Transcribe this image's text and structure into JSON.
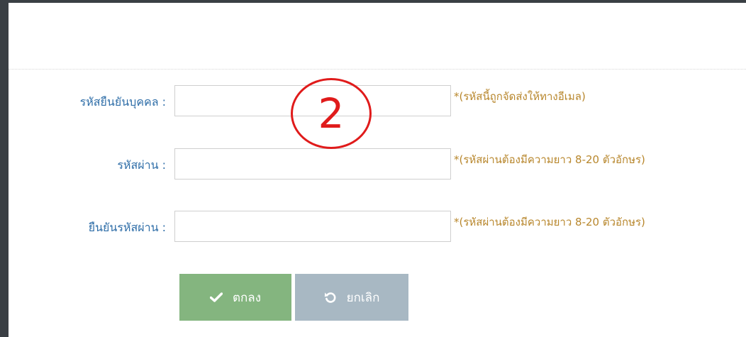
{
  "form": {
    "fields": [
      {
        "label": "รหัสยืนยันบุคคล :",
        "value": "",
        "hint": "*(รหัสนี้ถูกจัดส่งให้ทางอีเมล)"
      },
      {
        "label": "รหัสผ่าน :",
        "value": "",
        "hint": "*(รหัสผ่านต้องมีความยาว 8-20 ตัวอักษร)"
      },
      {
        "label": "ยืนยันรหัสผ่าน :",
        "value": "",
        "hint": "*(รหัสผ่านต้องมีความยาว 8-20 ตัวอักษร)"
      }
    ],
    "buttons": {
      "ok_label": "ตกลง",
      "cancel_label": "ยกเลิก"
    }
  },
  "annotation": {
    "step": "2",
    "color": "#e01b1b"
  },
  "icons": {
    "ok": "check-icon",
    "cancel": "undo-icon"
  },
  "colors": {
    "ok_button": "#84b57f",
    "cancel_button": "#a8b8c3",
    "label": "#2f6ea8",
    "hint": "#b8872d"
  }
}
